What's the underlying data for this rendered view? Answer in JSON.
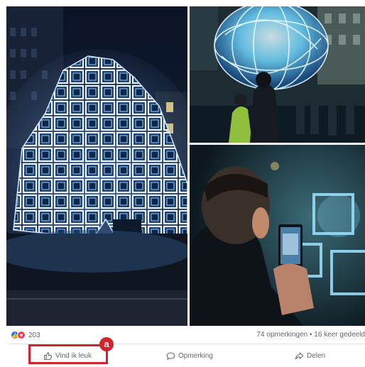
{
  "post": {
    "photos": [
      {
        "icon": "light-sculpture-photo"
      },
      {
        "icon": "light-globe-photo"
      },
      {
        "icon": "smartphone-photo"
      }
    ],
    "reactions": {
      "like_icon": "thumbs-up-icon",
      "love_icon": "heart-icon",
      "count": "203"
    },
    "stats": {
      "comments_shares": "74 opmerkingen • 16 keer gedeeld"
    },
    "actions": {
      "like_label": "Vind ik leuk",
      "comment_label": "Opmerking",
      "share_label": "Delen"
    }
  },
  "annotation": {
    "badge_label": "a",
    "color": "#d3232d"
  }
}
